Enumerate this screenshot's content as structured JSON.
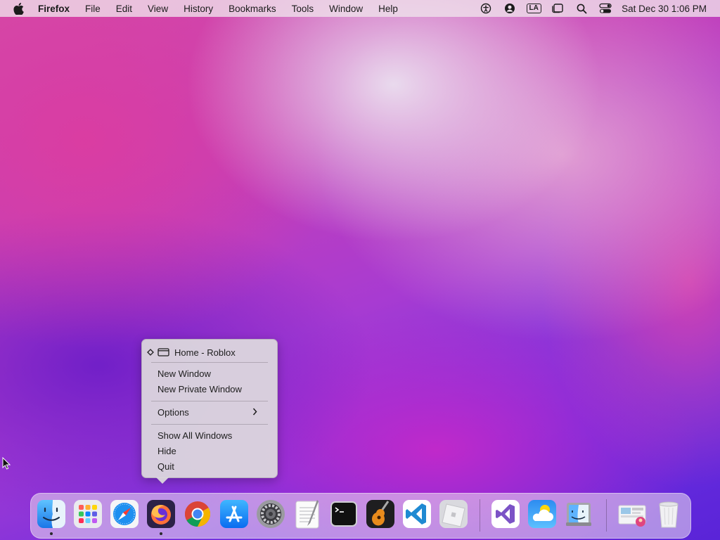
{
  "menubar": {
    "app_name": "Firefox",
    "menus": [
      "File",
      "Edit",
      "View",
      "History",
      "Bookmarks",
      "Tools",
      "Window",
      "Help"
    ],
    "input_source": "LA",
    "clock": "Sat Dec 30  1:06 PM"
  },
  "context_menu": {
    "window_title": "Home - Roblox",
    "new_window": "New Window",
    "new_private_window": "New Private Window",
    "options": "Options",
    "show_all_windows": "Show All Windows",
    "hide": "Hide",
    "quit": "Quit"
  },
  "dock": {
    "apps": [
      {
        "icon": "finder-icon",
        "running": true
      },
      {
        "icon": "launchpad-icon",
        "running": false
      },
      {
        "icon": "safari-icon",
        "running": false
      },
      {
        "icon": "firefox-icon",
        "running": true
      },
      {
        "icon": "chrome-icon",
        "running": false
      },
      {
        "icon": "app-store-icon",
        "running": false
      },
      {
        "icon": "system-settings-icon",
        "running": false
      },
      {
        "icon": "textedit-icon",
        "running": false
      },
      {
        "icon": "terminal-icon",
        "running": false
      },
      {
        "icon": "garageband-icon",
        "running": false
      },
      {
        "icon": "vscode-icon",
        "running": false
      },
      {
        "icon": "roblox-icon",
        "running": false
      },
      {
        "icon": "visual-studio-icon",
        "running": false
      },
      {
        "icon": "weather-icon",
        "running": false
      },
      {
        "icon": "migration-assistant-icon",
        "running": false
      },
      {
        "icon": "downloads-stack-icon",
        "running": false
      },
      {
        "icon": "trash-icon",
        "running": false
      }
    ]
  },
  "colors": {
    "menubar_bg": "#f0e4ec",
    "menu_bg": "#dedade",
    "firefox_orange": "#ff7139",
    "vscode_blue": "#1f8ad2",
    "safari_blue": "#1e8ff0"
  }
}
